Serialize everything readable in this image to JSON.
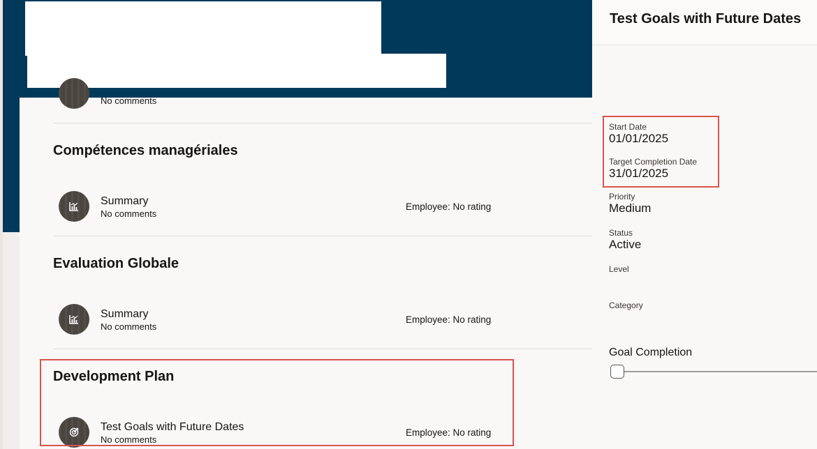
{
  "sections": [
    {
      "title": "",
      "row": {
        "title": "",
        "comments": "No comments",
        "rating": ""
      }
    },
    {
      "title": "Compétences managériales",
      "row": {
        "title": "Summary",
        "comments": "No comments",
        "rating": "Employee: No rating",
        "icon": "bar-chart-icon"
      }
    },
    {
      "title": "Evaluation Globale",
      "row": {
        "title": "Summary",
        "comments": "No comments",
        "rating": "Employee: No rating",
        "icon": "bar-chart-icon"
      }
    },
    {
      "title": "Development Plan",
      "row": {
        "title": "Test Goals with Future Dates",
        "comments": "No comments",
        "rating": "Employee: No rating",
        "icon": "target-icon"
      }
    }
  ],
  "panel": {
    "title": "Test Goals with Future Dates",
    "fields": {
      "start_date": {
        "label": "Start Date",
        "value": "01/01/2025"
      },
      "target_completion_date": {
        "label": "Target Completion Date",
        "value": "31/01/2025"
      },
      "priority": {
        "label": "Priority",
        "value": "Medium"
      },
      "status": {
        "label": "Status",
        "value": "Active"
      },
      "level": {
        "label": "Level",
        "value": ""
      },
      "category": {
        "label": "Category",
        "value": ""
      }
    },
    "goal_completion": {
      "label": "Goal Completion",
      "value_percent": 0
    }
  },
  "colors": {
    "header_band": "#00395a",
    "highlight": "#d9534f",
    "icon_bg": "#4b4540"
  }
}
